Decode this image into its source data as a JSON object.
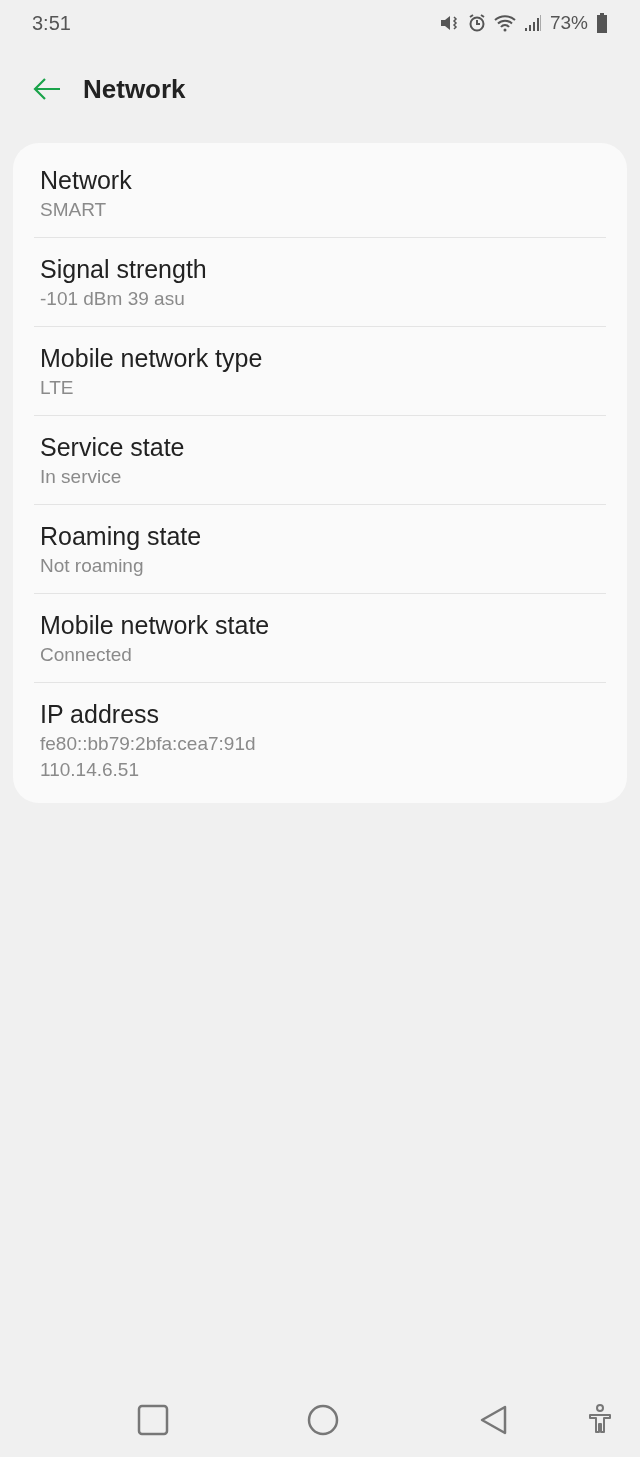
{
  "status_bar": {
    "time": "3:51",
    "battery": "73%"
  },
  "header": {
    "title": "Network"
  },
  "items": [
    {
      "title": "Network",
      "values": [
        "SMART"
      ]
    },
    {
      "title": "Signal strength",
      "values": [
        "-101 dBm 39 asu"
      ]
    },
    {
      "title": "Mobile network type",
      "values": [
        "LTE"
      ]
    },
    {
      "title": "Service state",
      "values": [
        "In service"
      ]
    },
    {
      "title": "Roaming state",
      "values": [
        "Not roaming"
      ]
    },
    {
      "title": "Mobile network state",
      "values": [
        "Connected"
      ]
    },
    {
      "title": "IP address",
      "values": [
        "fe80::bb79:2bfa:cea7:91d",
        "110.14.6.51"
      ]
    }
  ]
}
